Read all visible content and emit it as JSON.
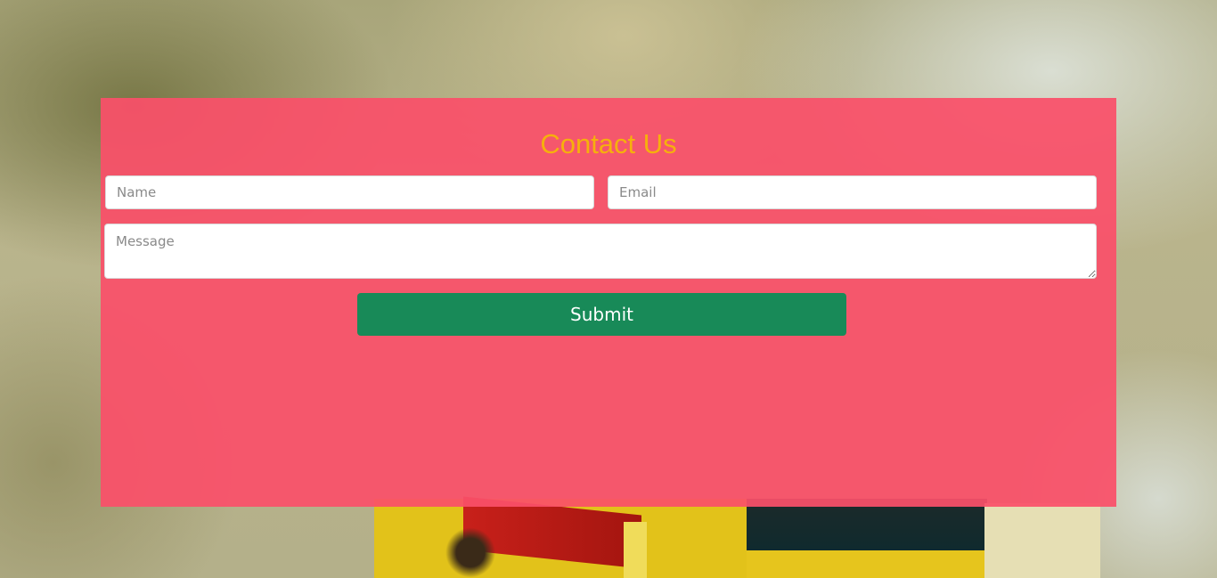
{
  "form": {
    "title": "Contact Us",
    "name_placeholder": "Name",
    "email_placeholder": "Email",
    "message_placeholder": "Message",
    "submit_label": "Submit"
  },
  "colors": {
    "panel": "#fa5069",
    "title": "#f6b00c",
    "submit": "#188a58"
  }
}
